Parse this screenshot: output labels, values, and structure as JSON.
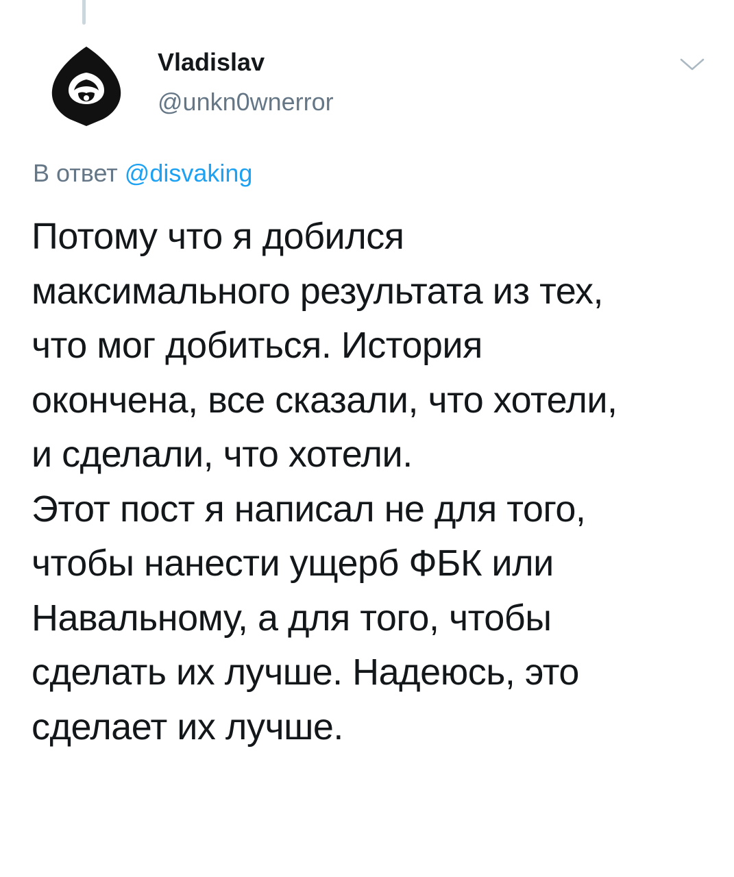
{
  "tweet": {
    "author_name": "Vladislav",
    "author_handle": "@unkn0wnerror",
    "reply_prefix": "В ответ",
    "reply_mention": "@disvaking",
    "text_lines": [
      "Потому что я добился",
      "максимального результата из тех,",
      "что мог добиться. История",
      "окончена, все сказали, что хотели,",
      "и сделали, что хотели.",
      "Этот пост я написал не для того,",
      "чтобы нанести ущерб ФБК или",
      "Навальному, а для того, чтобы",
      "сделать их лучше. Надеюсь, это",
      "сделает их лучше."
    ]
  },
  "icons": {
    "avatar": "hooded-figure-avatar",
    "menu": "chevron-down-icon"
  },
  "colors": {
    "text": "#14171a",
    "secondary": "#657786",
    "link": "#1da1f2",
    "thread_line": "#ccd6dd"
  }
}
